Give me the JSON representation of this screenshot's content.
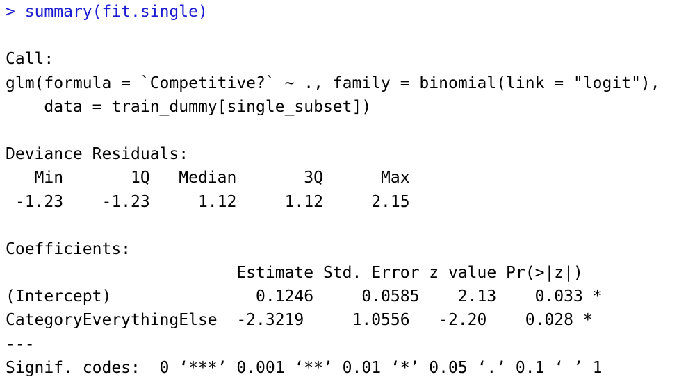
{
  "console": {
    "prompt": ">",
    "command": "summary(fit.single)",
    "call_header": "Call:",
    "call_line1": "glm(formula = `Competitive?` ~ ., family = binomial(link = \"logit\"),",
    "call_line2": "    data = train_dummy[single_subset])",
    "deviance_header": "Deviance Residuals:",
    "deviance_labels": "   Min       1Q   Median       3Q      Max  ",
    "deviance_values": " -1.23    -1.23     1.12     1.12     2.15  ",
    "coef_header": "Coefficients:",
    "coef_columns": "                        Estimate Std. Error z value Pr(>|z|)  ",
    "coef_rows": [
      "(Intercept)               0.1246     0.0585    2.13    0.033 *",
      "CategoryEverythingElse  -2.3219     1.0556   -2.20    0.028 *"
    ],
    "separator": "---",
    "signif_codes": "Signif. codes:  0 ‘***’ 0.001 ‘**’ 0.01 ‘*’ 0.05 ‘.’ 0.1 ‘ ’ 1",
    "colors": {
      "command": "#1c1cd0",
      "output": "#000000",
      "background": "#ffffff"
    }
  }
}
